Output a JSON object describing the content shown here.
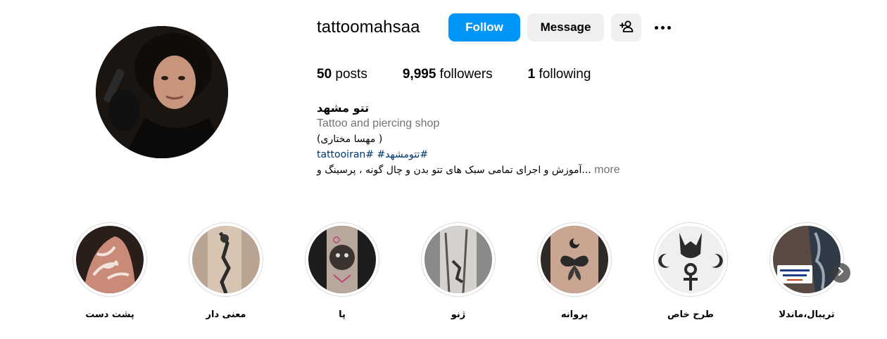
{
  "profile": {
    "username": "tattoomahsaa",
    "follow_label": "Follow",
    "message_label": "Message",
    "add_user_icon": "person-add-icon",
    "more_icon": "more-horizontal-icon"
  },
  "stats": {
    "posts_count": "50",
    "posts_label": " posts",
    "followers_count": "9,995",
    "followers_label": " followers",
    "following_count": "1",
    "following_label": " following"
  },
  "bio": {
    "name": "تتو مشهد",
    "category": "Tattoo and piercing shop",
    "fullname_line": "(مهسا مختاری )",
    "hashtags": "tattooiran# #تتومشهد#",
    "description": "آموزش و اجرای تمامی سبک های تتو بدن و چال گونه ، پرسینگ و...",
    "more_label": "more"
  },
  "highlights": [
    {
      "label": "پشت دست"
    },
    {
      "label": "معنی دار"
    },
    {
      "label": "پا"
    },
    {
      "label": "ژنو"
    },
    {
      "label": "پروانه"
    },
    {
      "label": "طرح خاص"
    },
    {
      "label": "تریبال،ماندلا"
    }
  ],
  "colors": {
    "follow_bg": "#0095f6",
    "secondary_bg": "#efefef",
    "hashtag": "#00376b",
    "muted": "#737373"
  }
}
